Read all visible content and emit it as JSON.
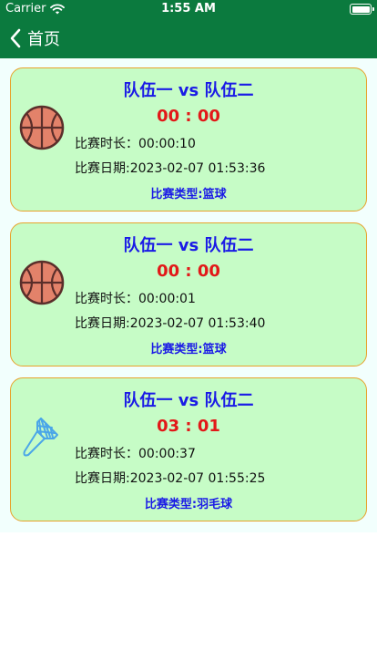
{
  "status_bar": {
    "carrier": "Carrier",
    "time": "1:55 AM"
  },
  "nav": {
    "back_label": "首页"
  },
  "matches": [
    {
      "title": "队伍一 vs 队伍二",
      "score": "00 : 00",
      "duration": "比赛时长：00:00:10",
      "date": "比赛日期:2023-02-07 01:53:36",
      "type": "比赛类型:篮球",
      "icon": "basketball-icon"
    },
    {
      "title": "队伍一 vs 队伍二",
      "score": "00 : 00",
      "duration": "比赛时长：00:00:01",
      "date": "比赛日期:2023-02-07 01:53:40",
      "type": "比赛类型:篮球",
      "icon": "basketball-icon"
    },
    {
      "title": "队伍一 vs 队伍二",
      "score": "03 : 01",
      "duration": "比赛时长：00:00:37",
      "date": "比赛日期:2023-02-07 01:55:25",
      "type": "比赛类型:羽毛球",
      "icon": "shuttlecock-icon"
    }
  ],
  "colors": {
    "nav_bg": "#0b7a3e",
    "card_bg": "#c6fcc6",
    "card_border": "#e8a22c",
    "title_text": "#1a1ae6",
    "score_text": "#e21818"
  }
}
